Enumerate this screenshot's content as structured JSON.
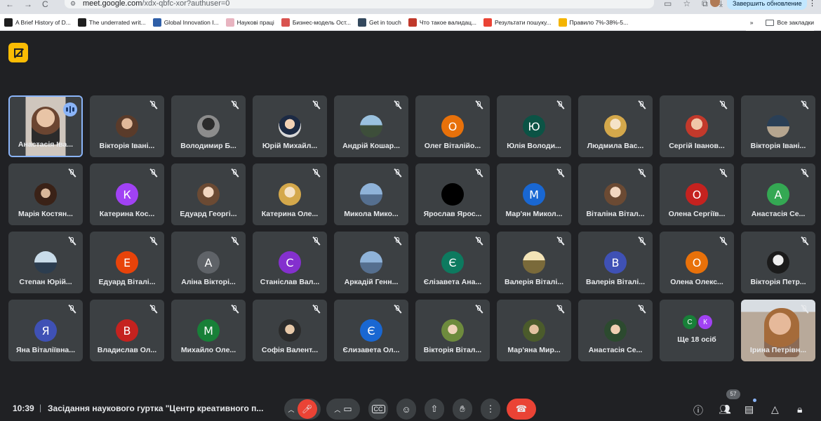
{
  "browser": {
    "nav_back": "←",
    "nav_forward": "→",
    "nav_reload": "C",
    "url_host": "meet.google.com",
    "url_path": "/xdx-qbfc-xor?authuser=0",
    "update_label": "Завершить обновление",
    "bookmarks": [
      {
        "label": "A Brief History of D...",
        "color": "#1f1f1f"
      },
      {
        "label": "The underrated writ...",
        "color": "#1f1f1f"
      },
      {
        "label": "Global Innovation I...",
        "color": "#2f5fa8"
      },
      {
        "label": "Наукові праці",
        "color": "#e8b4c0"
      },
      {
        "label": "Бизнес-модель Ост...",
        "color": "#d9534f"
      },
      {
        "label": "Get in touch",
        "color": "#34495e"
      },
      {
        "label": "Что такое валидац...",
        "color": "#c0392b"
      },
      {
        "label": "Результати пошуку...",
        "color": "#ea4335"
      },
      {
        "label": "Правило 7%-38%-5...",
        "color": "#f4b400"
      }
    ],
    "more_bookmarks": "»",
    "all_bookmarks": "Все закладки"
  },
  "participants": [
    {
      "name": "Анастасія Іва...",
      "type": "video"
    },
    {
      "name": "Вікторія Івані...",
      "type": "photo",
      "style": "p1"
    },
    {
      "name": "Володимир Б...",
      "type": "photo",
      "style": "p2"
    },
    {
      "name": "Юрій Михайл...",
      "type": "photo",
      "style": "p3"
    },
    {
      "name": "Андрій Кошар...",
      "type": "photo",
      "style": "p4"
    },
    {
      "name": "Олег Віталійо...",
      "type": "letter",
      "letter": "О",
      "color": "#e8710a"
    },
    {
      "name": "Юлія Володи...",
      "type": "letter",
      "letter": "Ю",
      "color": "#0b5345"
    },
    {
      "name": "Людмила Вас...",
      "type": "photo",
      "style": "p5"
    },
    {
      "name": "Сергій Іванов...",
      "type": "photo",
      "style": "p6"
    },
    {
      "name": "Вікторія Івані...",
      "type": "photo",
      "style": "p7"
    },
    {
      "name": "Марія Костян...",
      "type": "photo",
      "style": "p9"
    },
    {
      "name": "Катерина Кос...",
      "type": "letter",
      "letter": "К",
      "color": "#a142f4"
    },
    {
      "name": "Едуард Георгі...",
      "type": "photo",
      "style": "p14"
    },
    {
      "name": "Катерина Оле...",
      "type": "photo",
      "style": "p5"
    },
    {
      "name": "Микола Мико...",
      "type": "photo",
      "style": "p8"
    },
    {
      "name": "Ярослав Ярос...",
      "type": "photo",
      "style": "p10"
    },
    {
      "name": "Мар'ян Микол...",
      "type": "letter",
      "letter": "М",
      "color": "#1967d2"
    },
    {
      "name": "Віталіна Вітал...",
      "type": "photo",
      "style": "p14"
    },
    {
      "name": "Олена Сергіїв...",
      "type": "letter",
      "letter": "О",
      "color": "#c5221f"
    },
    {
      "name": "Анастасія Се...",
      "type": "letter",
      "letter": "А",
      "color": "#34a853"
    },
    {
      "name": "Степан Юрій...",
      "type": "photo",
      "style": "p13"
    },
    {
      "name": "Едуард Віталі...",
      "type": "letter",
      "letter": "Е",
      "color": "#e8430a"
    },
    {
      "name": "Аліна Вікторі...",
      "type": "letter",
      "letter": "А",
      "color": "#5f6368"
    },
    {
      "name": "Станіслав Вал...",
      "type": "letter",
      "letter": "С",
      "color": "#8430ce"
    },
    {
      "name": "Аркадій Генн...",
      "type": "photo",
      "style": "p8"
    },
    {
      "name": "Єлізавета Ана...",
      "type": "letter",
      "letter": "Є",
      "color": "#0d7a5f"
    },
    {
      "name": "Валерія Віталі...",
      "type": "photo",
      "style": "p11"
    },
    {
      "name": "Валерія Віталі...",
      "type": "letter",
      "letter": "В",
      "color": "#3f51b5"
    },
    {
      "name": "Олена Олекс...",
      "type": "letter",
      "letter": "О",
      "color": "#e8710a"
    },
    {
      "name": "Вікторія Петр...",
      "type": "photo",
      "style": "p12"
    },
    {
      "name": "Яна Віталіївна...",
      "type": "letter",
      "letter": "Я",
      "color": "#3f51b5"
    },
    {
      "name": "Владислав Ол...",
      "type": "letter",
      "letter": "В",
      "color": "#c5221f"
    },
    {
      "name": "Михайло Оле...",
      "type": "letter",
      "letter": "М",
      "color": "#188038"
    },
    {
      "name": "Софія Валент...",
      "type": "photo",
      "style": "p15"
    },
    {
      "name": "Єлизавета Ол...",
      "type": "letter",
      "letter": "Є",
      "color": "#1967d2"
    },
    {
      "name": "Вікторія Вітал...",
      "type": "photo",
      "style": "p16"
    },
    {
      "name": "Мар'яна Мир...",
      "type": "photo",
      "style": "p17"
    },
    {
      "name": "Анастасія Се...",
      "type": "photo",
      "style": "p18"
    },
    {
      "name": "Ще 18 осіб",
      "type": "more",
      "avatars": [
        {
          "letter": "С",
          "color": "#188038"
        },
        {
          "letter": "К",
          "color": "#a142f4"
        }
      ]
    },
    {
      "name": "Ірина Петрівн...",
      "type": "video2"
    }
  ],
  "footer": {
    "time": "10:39",
    "separator": "|",
    "meeting_title": "Засідання наукового гуртка \"Центр креативного п...",
    "participants_count": "57"
  }
}
